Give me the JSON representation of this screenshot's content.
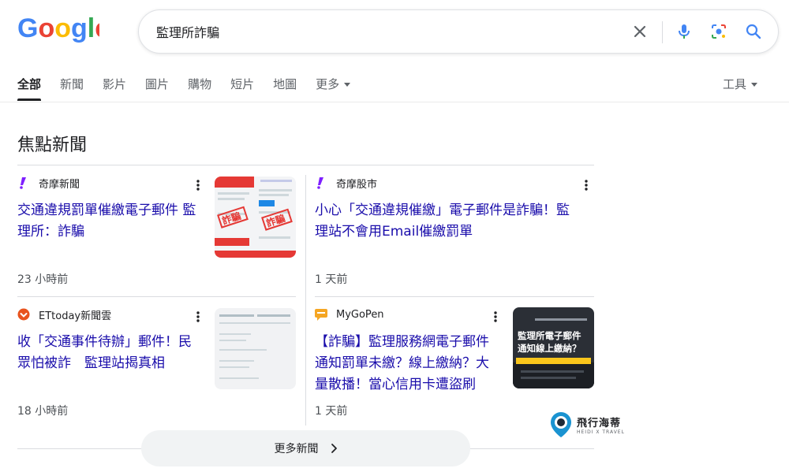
{
  "header": {
    "logo_text": "Google",
    "search_query": "監理所詐騙",
    "colors": {
      "blue": "#4285F4",
      "red": "#EA4335",
      "yellow": "#FBBC05",
      "green": "#34A853",
      "link": "#1a0dab"
    }
  },
  "tabs": [
    {
      "label": "全部",
      "active": true
    },
    {
      "label": "新聞"
    },
    {
      "label": "影片"
    },
    {
      "label": "圖片"
    },
    {
      "label": "購物"
    },
    {
      "label": "短片"
    },
    {
      "label": "地圖"
    },
    {
      "label": "更多"
    }
  ],
  "tools_label": "工具",
  "top_stories": {
    "title": "焦點新聞",
    "cards": [
      {
        "source": "奇摩新聞",
        "headline_lines": [
          "交通違規罰單催繳電子郵件 監",
          "理所：詐騙"
        ],
        "time": "23 小時前",
        "logo": "yahoo-icon"
      },
      {
        "source": "奇摩股市",
        "headline_lines": [
          "小心「交通違規催繳」電子郵件是詐騙！監",
          "理站不會用Email催繳罰單"
        ],
        "time": "1 天前",
        "logo": "yahoo-icon"
      },
      {
        "source": "ETtoday新聞雲",
        "headline_lines": [
          "收「交通事件待辦」郵件！民",
          "眾怕被詐　監理站揭真相"
        ],
        "time": "18 小時前",
        "logo": "ettoday-icon"
      },
      {
        "source": "MyGoPen",
        "headline_lines": [
          "【詐騙】監理服務網電子郵件",
          "通知罰單未繳？線上繳納？大",
          "量散播！當心信用卡遭盜刷"
        ],
        "time": "1 天前",
        "logo": "mygopen-icon"
      }
    ],
    "thumb1_stamp": "詐騙",
    "thumb4_lines": [
      "監理所電子郵件",
      "通知線上繳納？"
    ],
    "more_label": "更多新聞"
  },
  "watermark": {
    "main": "飛行海蒂",
    "sub": "HEIDI X TRAVEL"
  }
}
